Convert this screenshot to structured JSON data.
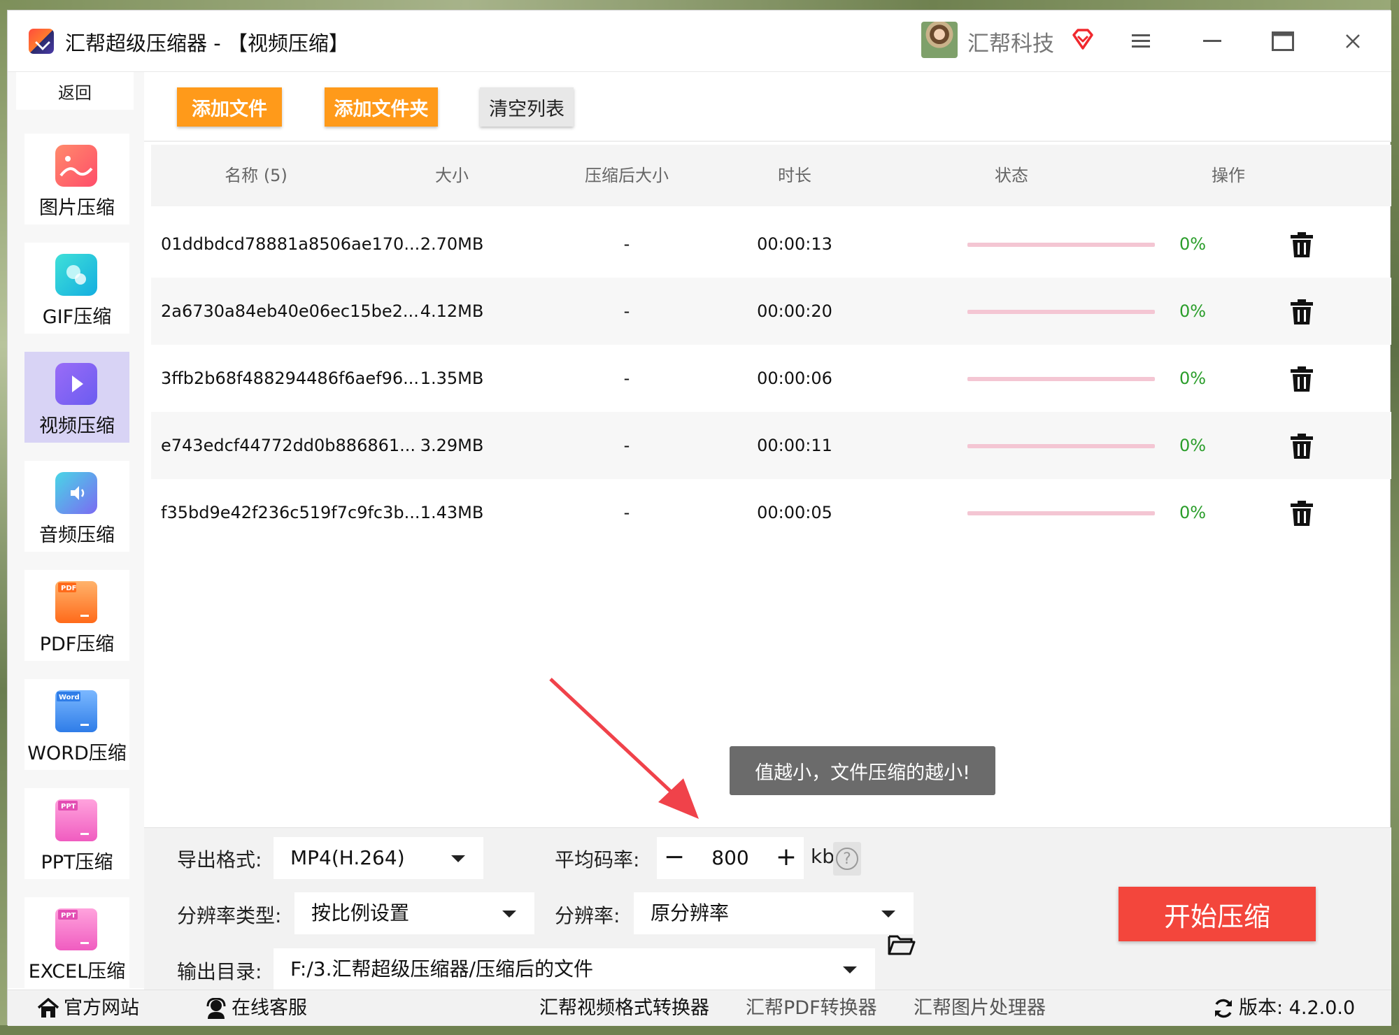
{
  "window": {
    "title": "汇帮超级压缩器  - 【视频压缩】",
    "company": "汇帮科技"
  },
  "sidebar": {
    "back_label": "返回",
    "items": [
      {
        "label": "图片压缩",
        "icon": "image-compress-icon",
        "color": "#ff5e6a"
      },
      {
        "label": "GIF压缩",
        "icon": "gif-compress-icon",
        "color": "#22c6d6"
      },
      {
        "label": "视频压缩",
        "icon": "video-compress-icon",
        "color": "#7a6cf2"
      },
      {
        "label": "音频压缩",
        "icon": "audio-compress-icon",
        "color": "#5a9cf5"
      },
      {
        "label": "PDF压缩",
        "icon": "pdf-compress-icon",
        "color": "#ff7a2e"
      },
      {
        "label": "WORD压缩",
        "icon": "word-compress-icon",
        "color": "#3a8ef5"
      },
      {
        "label": "PPT压缩",
        "icon": "ppt-compress-icon",
        "color": "#f26bc6"
      },
      {
        "label": "EXCEL压缩",
        "icon": "excel-compress-icon",
        "color": "#f26bc6"
      }
    ],
    "active_index": 2
  },
  "toolbar": {
    "add_file": "添加文件",
    "add_folder": "添加文件夹",
    "clear_list": "清空列表"
  },
  "table": {
    "columns": [
      "名称 (5)",
      "大小",
      "压缩后大小",
      "时长",
      "状态",
      "操作"
    ],
    "rows": [
      {
        "name": "01ddbdcd78881a8506ae170...",
        "size": "2.70MB",
        "compressed": "-",
        "duration": "00:00:13",
        "progress": 0,
        "status": "0%"
      },
      {
        "name": "2a6730a84eb40e06ec15be2...",
        "size": "4.12MB",
        "compressed": "-",
        "duration": "00:00:20",
        "progress": 0,
        "status": "0%"
      },
      {
        "name": "3ffb2b68f488294486f6aef96...",
        "size": "1.35MB",
        "compressed": "-",
        "duration": "00:00:06",
        "progress": 0,
        "status": "0%"
      },
      {
        "name": "e743edcf44772dd0b886861...",
        "size": "3.29MB",
        "compressed": "-",
        "duration": "00:00:11",
        "progress": 0,
        "status": "0%"
      },
      {
        "name": "f35bd9e42f236c519f7c9fc3b...",
        "size": "1.43MB",
        "compressed": "-",
        "duration": "00:00:05",
        "progress": 0,
        "status": "0%"
      }
    ]
  },
  "tooltip": "值越小，文件压缩的越小!",
  "settings": {
    "format_label": "导出格式:",
    "format_value": "MP4(H.264)",
    "bitrate_label": "平均码率:",
    "bitrate_minus": "−",
    "bitrate_value": "800",
    "bitrate_plus": "+",
    "bitrate_unit": "kb",
    "help_glyph": "?",
    "res_type_label": "分辨率类型:",
    "res_type_value": "按比例设置",
    "res_label": "分辨率:",
    "res_value": "原分辨率",
    "output_label": "输出目录:",
    "output_value": "F:/3.汇帮超级压缩器/压缩后的文件",
    "start_label": "开始压缩"
  },
  "footer": {
    "website": "官方网站",
    "support": "在线客服",
    "link1": "汇帮视频格式转换器",
    "link2": "汇帮PDF转换器",
    "link3": "汇帮图片处理器",
    "version": "版本: 4.2.0.0"
  },
  "colors": {
    "accent_orange": "#ff9a1a",
    "start_red": "#f3463c",
    "active_sidebar": "#d8d3f5",
    "progress_track": "#f4c6d3",
    "status_green": "#2a9d2a"
  }
}
